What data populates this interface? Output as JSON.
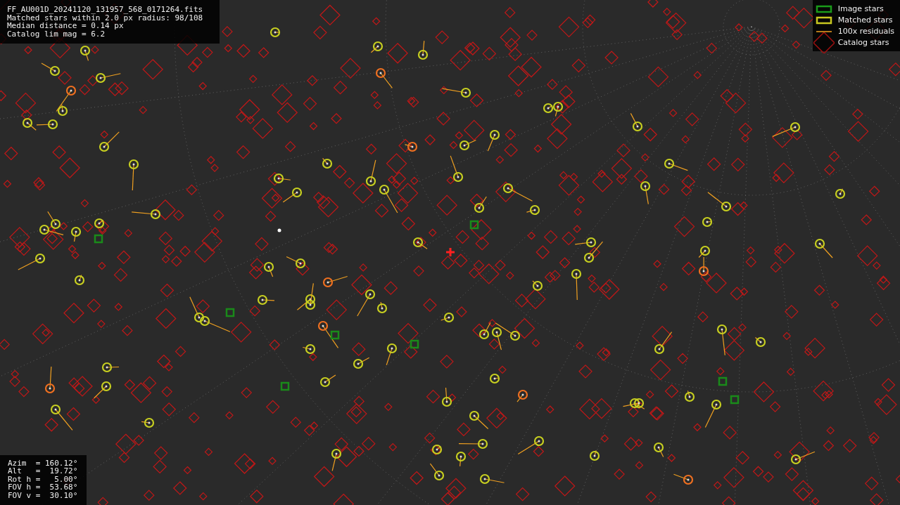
{
  "file_info": {
    "lines": [
      "FF_AU001D_20241120_131957_568_0171264.fits",
      "Matched stars within 2.0 px radius: 98/108",
      "Median distance = 0.14 px",
      "Catalog lim mag = 6.2"
    ]
  },
  "legend": {
    "items": [
      {
        "kind": "image",
        "label": "Image stars"
      },
      {
        "kind": "matched",
        "label": "Matched stars"
      },
      {
        "kind": "residual",
        "label": "100x residuals"
      },
      {
        "kind": "catalog",
        "label": "Catalog stars"
      }
    ]
  },
  "pointing": {
    "lines": [
      "Azim  = 160.12°",
      "Alt   =  19.72°",
      "Rot h =   5.00°",
      "FOV h =  53.68°",
      "FOV v =  30.10°"
    ]
  }
}
